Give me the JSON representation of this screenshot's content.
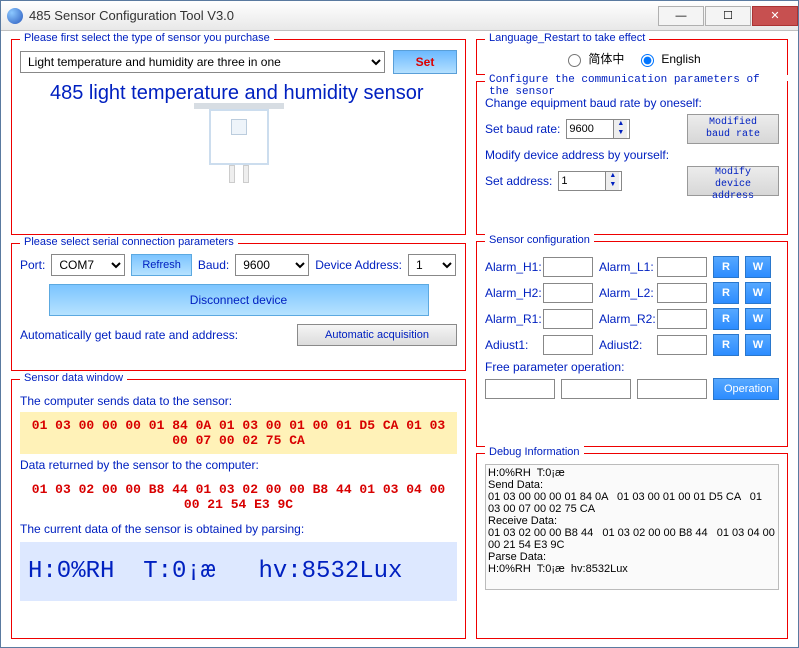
{
  "window": {
    "title": "485 Sensor Configuration Tool V3.0"
  },
  "sensorType": {
    "legend": "Please first select the type of sensor you purchase",
    "selected": "Light temperature and humidity are three in one",
    "setBtn": "Set",
    "title": "485 light temperature and humidity sensor"
  },
  "serial": {
    "legend": "Please select serial connection parameters",
    "portLabel": "Port:",
    "portValue": "COM7",
    "refreshBtn": "Refresh",
    "baudLabel": "Baud:",
    "baudValue": "9600",
    "addrLabel": "Device Address:",
    "addrValue": "1",
    "disconnectBtn": "Disconnect device",
    "autoLabel": "Automatically get baud rate and address:",
    "autoBtn": "Automatic acquisition"
  },
  "sensorData": {
    "legend": "Sensor data window",
    "sendLabel": "The computer sends data to the sensor:",
    "sendHex": "01 03 00 00 00 01 84 0A   01 03 00 01 00 01 D5 CA   01 03 00 07 00 02 75 CA",
    "recvLabel": "Data returned by the sensor to the computer:",
    "recvHex": "01 03 02 00 00 B8 44   01 03 02 00 00 B8 44   01 03 04 00 00 21 54 E3 9C",
    "parseLabel": "The current data of the sensor is obtained by parsing:",
    "parsed": "H:0%RH  T:0¡æ   hv:8532Lux"
  },
  "language": {
    "legend": "Language_Restart to take effect",
    "opt1": "简体中",
    "opt2": "English"
  },
  "commParams": {
    "legend": "Configure the communication parameters of the sensor",
    "line1": "Change equipment baud rate by oneself:",
    "baudLabel": "Set baud rate:",
    "baudValue": "9600",
    "baudBtn": "Modified baud rate",
    "line2": "Modify device address by yourself:",
    "addrLabel": "Set address:",
    "addrValue": "1",
    "addrBtn": "Modify device address"
  },
  "sensorConf": {
    "legend": "Sensor configuration",
    "alarm_h1": "Alarm_H1:",
    "alarm_l1": "Alarm_L1:",
    "alarm_h2": "Alarm_H2:",
    "alarm_l2": "Alarm_L2:",
    "alarm_r1": "Alarm_R1:",
    "alarm_r2": "Alarm_R2:",
    "adjust1": "Adiust1:",
    "adjust2": "Adiust2:",
    "r": "R",
    "w": "W",
    "freeLabel": "Free parameter operation:",
    "opBtn": "Operation"
  },
  "debug": {
    "legend": "Debug Information",
    "text": "H:0%RH  T:0¡æ\nSend Data:\n01 03 00 00 00 01 84 0A   01 03 00 01 00 01 D5 CA   01 03 00 07 00 02 75 CA\nReceive Data:\n01 03 02 00 00 B8 44   01 03 02 00 00 B8 44   01 03 04 00 00 21 54 E3 9C\nParse Data:\nH:0%RH  T:0¡æ  hv:8532Lux"
  }
}
